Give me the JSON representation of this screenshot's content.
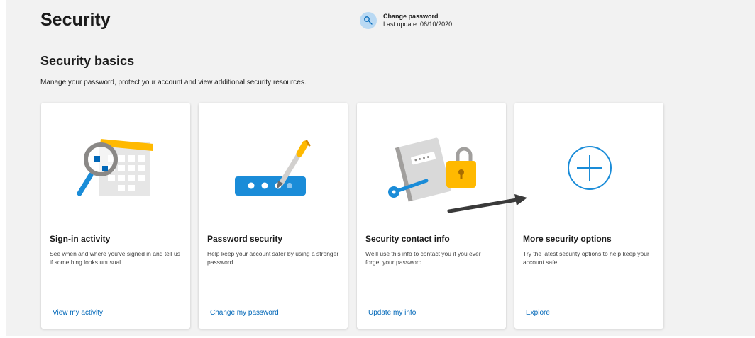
{
  "header": {
    "title": "Security",
    "password_status": {
      "title": "Change password",
      "subtitle": "Last update: 06/10/2020",
      "icon": "key-icon"
    }
  },
  "section": {
    "title": "Security basics",
    "description": "Manage your password, protect your account and view additional security resources."
  },
  "cards": [
    {
      "title": "Sign-in activity",
      "description": "See when and where you've signed in and tell us if something looks unusual.",
      "link": "View my activity",
      "icon": "calendar-magnifier-icon"
    },
    {
      "title": "Password security",
      "description": "Help keep your account safer by using a stronger password.",
      "link": "Change my password",
      "icon": "password-pen-icon"
    },
    {
      "title": "Security contact info",
      "description": "We'll use this info to contact you if you ever forget your password.",
      "link": "Update my info",
      "icon": "contact-lock-icon"
    },
    {
      "title": "More security options",
      "description": "Try the latest security options to help keep your account safe.",
      "link": "Explore",
      "icon": "plus-circle-icon"
    }
  ],
  "colors": {
    "accent": "#0067b8",
    "background": "#f2f2f2",
    "card": "#ffffff",
    "arrow": "#3a3a3a"
  }
}
